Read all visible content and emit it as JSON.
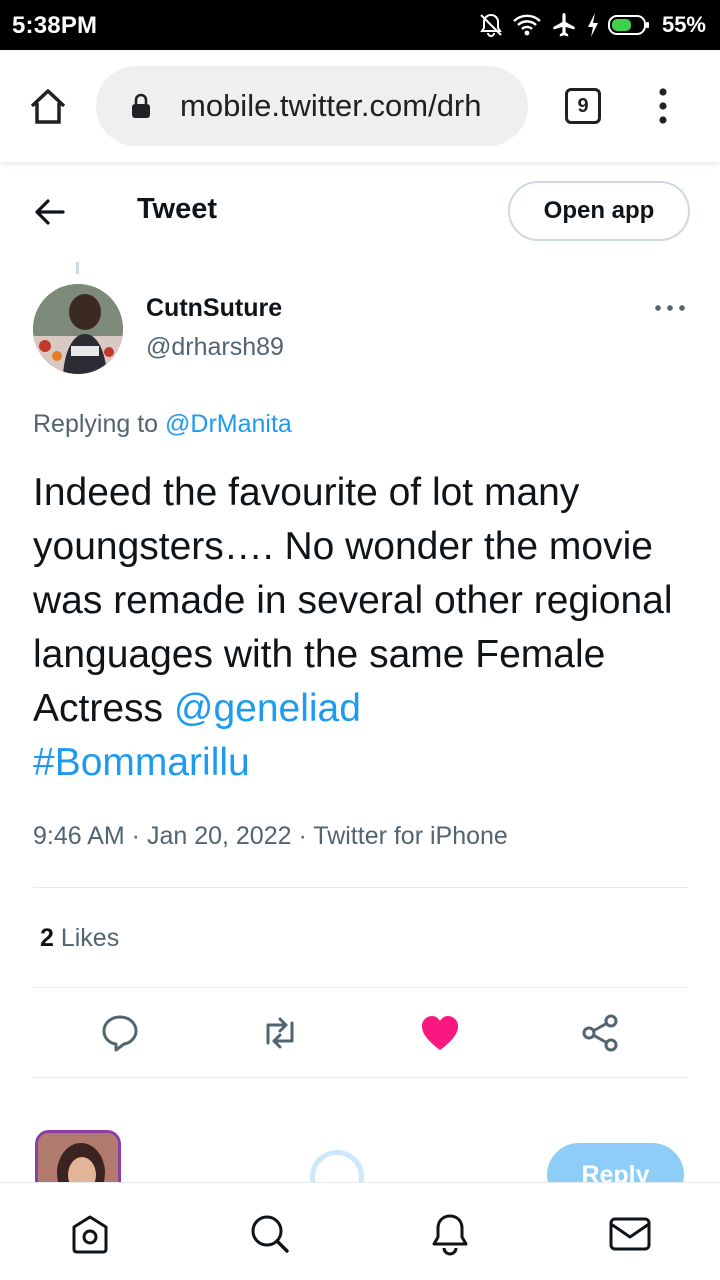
{
  "status_bar": {
    "time": "5:38PM",
    "battery_percent": "55%",
    "icons": [
      "mute-icon",
      "wifi-icon",
      "airplane-icon",
      "charging-icon",
      "battery-icon"
    ]
  },
  "browser": {
    "url": "mobile.twitter.com/drh",
    "tab_count": "9",
    "icons": [
      "home-icon",
      "lock-icon",
      "tabs-icon",
      "menu-icon"
    ]
  },
  "header": {
    "title": "Tweet",
    "open_app_label": "Open app"
  },
  "tweet": {
    "author_name": "CutnSuture",
    "author_handle": "@drharsh89",
    "replying_prefix": "Replying to ",
    "replying_to": "@DrManita",
    "text": "Indeed the favourite of lot many youngsters…. No wonder the movie was remade in several other regional languages with the same Female Actress ",
    "mention": "@geneliad",
    "hashtag": "#Bommarillu",
    "time": "9:46 AM",
    "date": "Jan 20, 2022",
    "source": "Twitter for iPhone",
    "separator": " · ",
    "likes_count": "2",
    "likes_label": " Likes",
    "liked": true
  },
  "composer": {
    "reply_label": "Reply"
  },
  "bottom_nav": {
    "items": [
      "home-icon",
      "search-icon",
      "notifications-icon",
      "messages-icon"
    ]
  },
  "colors": {
    "accent": "#1d9bf0",
    "like": "#f91880",
    "text_secondary": "#536471"
  }
}
